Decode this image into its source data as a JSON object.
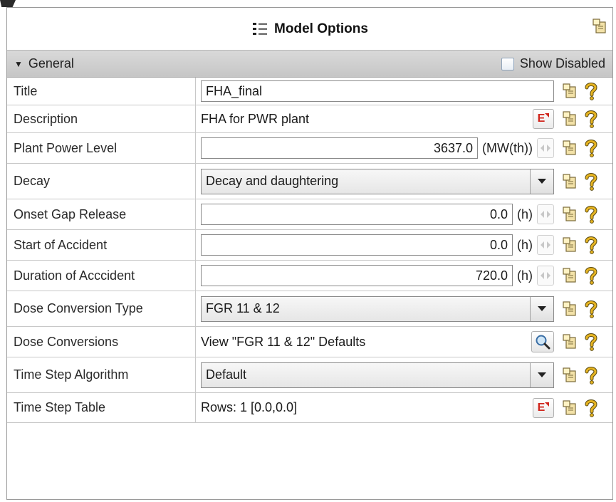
{
  "panel": {
    "title": "Model Options"
  },
  "section": {
    "label": "General",
    "show_disabled_label": "Show Disabled"
  },
  "rows": [
    {
      "label": "Title",
      "kind": "text",
      "value": "FHA_final"
    },
    {
      "label": "Description",
      "kind": "edit",
      "value": "FHA for PWR plant"
    },
    {
      "label": "Plant Power Level",
      "kind": "number",
      "value": "3637.0",
      "unit": "(MW(th))"
    },
    {
      "label": "Decay",
      "kind": "select",
      "value": "Decay and daughtering"
    },
    {
      "label": "Onset Gap Release",
      "kind": "number",
      "value": "0.0",
      "unit": "(h)"
    },
    {
      "label": "Start of Accident",
      "kind": "number",
      "value": "0.0",
      "unit": "(h)"
    },
    {
      "label": "Duration of Acccident",
      "kind": "number",
      "value": "720.0",
      "unit": "(h)"
    },
    {
      "label": "Dose Conversion Type",
      "kind": "select",
      "value": "FGR 11 & 12"
    },
    {
      "label": "Dose Conversions",
      "kind": "view",
      "value": "View \"FGR 11 & 12\" Defaults"
    },
    {
      "label": "Time Step Algorithm",
      "kind": "select",
      "value": "Default"
    },
    {
      "label": "Time Step Table",
      "kind": "edit",
      "value": "Rows: 1 [0.0,0.0]"
    }
  ],
  "edit_button_glyph": "E",
  "icons": {
    "title": "list-icon",
    "corner": "pin-notes-icon",
    "notes": "pin-notes-icon",
    "help": "question-mark-icon",
    "dropdown": "chevron-down-icon",
    "spinner": "spinner-arrows-icon",
    "search": "magnifier-icon"
  },
  "colors": {
    "section_bg": "#cfcfcf",
    "edit_red": "#d0261d",
    "help_gold": "#d9a514"
  }
}
